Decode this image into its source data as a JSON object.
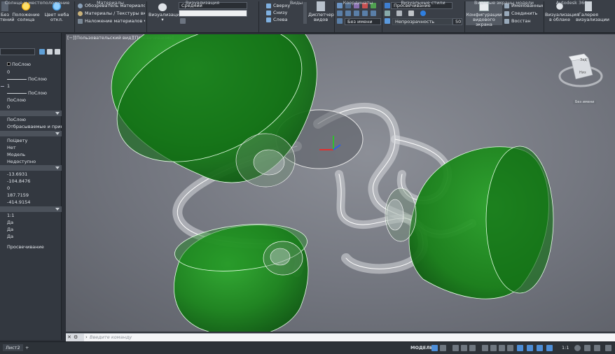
{
  "ribbon": {
    "sun_cut": "Без",
    "sun_cut2": "тений",
    "sun_position": "Положение",
    "sun_position2": "солнца",
    "sky_off": "Цвет неба откл.",
    "sun_panel_title": "Солнце и местоположение",
    "materials_browser": "Обозреватель материалов",
    "materials_textures": "Материалы / Текстуры вкл.",
    "apply_materials": "Наложение материалов",
    "materials_title": "Материалы",
    "render_button": "Визуализация",
    "render_quality": "Средний",
    "render_title": "Визуализация",
    "view_top": "Сверху",
    "view_bottom": "Снизу",
    "view_left": "Слева",
    "views_title": "Виды",
    "view_manager": "Диспетчер",
    "view_manager2": "видов",
    "ucs_name": "Без имени",
    "coords_title": "Координаты",
    "visual_style": "Просвечивание",
    "edge_opacity": "Непрозрачность",
    "opacity_value": "50",
    "visual_styles_title": "Визуальные стили",
    "viewport_config": "Конфигурации",
    "viewport_config2": "видового экрана",
    "named": "Именованные",
    "join": "Соединить",
    "restore": "Восстан",
    "viewports_title": "Видовые экраны модели",
    "cloud_render": "Визуализация",
    "cloud_render2": "в облаке",
    "gallery": "Галерея",
    "gallery2": "визуализации",
    "a360_title": "Autodesk 360"
  },
  "panel": {
    "color": "ПоСлою",
    "zero1": "0",
    "layer": "ПоСлою",
    "scale": "1",
    "linetype": "ПоСлою",
    "lineweight": "ПоСлою",
    "zero2": "0",
    "material": "ПоСлою",
    "shadows": "Отбрасываемые и прини...",
    "plotstyle": "ПоЦвету",
    "no": "Нет",
    "model": "Модель",
    "unavailable": "Недоступно",
    "c1": "-13.6931",
    "c2": "-104.8476",
    "c3": "0",
    "c4": "187.7159",
    "c5": "-414.9154",
    "ratio": "1:1",
    "yes1": "Да",
    "yes2": "Да",
    "yes3": "Да",
    "visual_style": "Просвечивание"
  },
  "viewport": {
    "label": "[−][Пользовательский вид][Просвечивание]",
    "viewcube_top": "Зад",
    "viewcube_front": "Низ",
    "wcs": "Без имени"
  },
  "command": {
    "placeholder": "Введите команду"
  },
  "status": {
    "layout_tab": "Лист2",
    "model": "МОДЕЛЬ",
    "scale": "1:1"
  },
  "colors": {
    "glass_green": "#1f8a1f",
    "viewport_bg": "#7a7d85",
    "ribbon_bg": "#3a3f47"
  }
}
